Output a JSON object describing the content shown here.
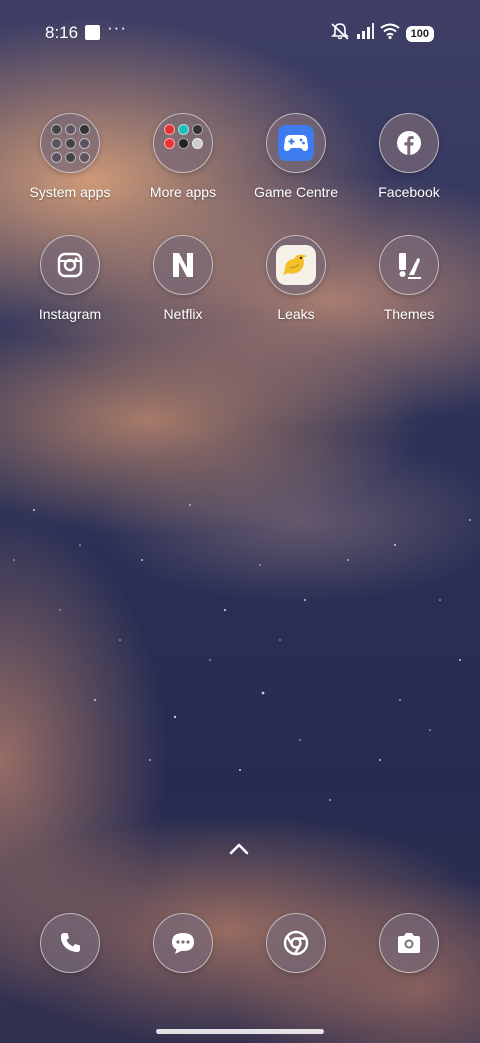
{
  "status_bar": {
    "time": "8:16",
    "more": "···",
    "battery": "100"
  },
  "apps": [
    {
      "label": "System apps",
      "icon": "folder-icon"
    },
    {
      "label": "More apps",
      "icon": "folder-icon"
    },
    {
      "label": "Game Centre",
      "icon": "gamepad-icon"
    },
    {
      "label": "Facebook",
      "icon": "facebook-icon"
    },
    {
      "label": "Instagram",
      "icon": "instagram-icon"
    },
    {
      "label": "Netflix",
      "icon": "netflix-icon"
    },
    {
      "label": "Leaks",
      "icon": "bird-icon"
    },
    {
      "label": "Themes",
      "icon": "brush-icon"
    }
  ],
  "dock": [
    {
      "icon": "phone-icon"
    },
    {
      "icon": "chat-icon"
    },
    {
      "icon": "chrome-icon"
    },
    {
      "icon": "camera-icon"
    }
  ],
  "colors": {
    "game_centre_bg": "#3e7bef",
    "leaks_bg": "#f6f1e6",
    "leaks_bird": "#f3c02a"
  }
}
